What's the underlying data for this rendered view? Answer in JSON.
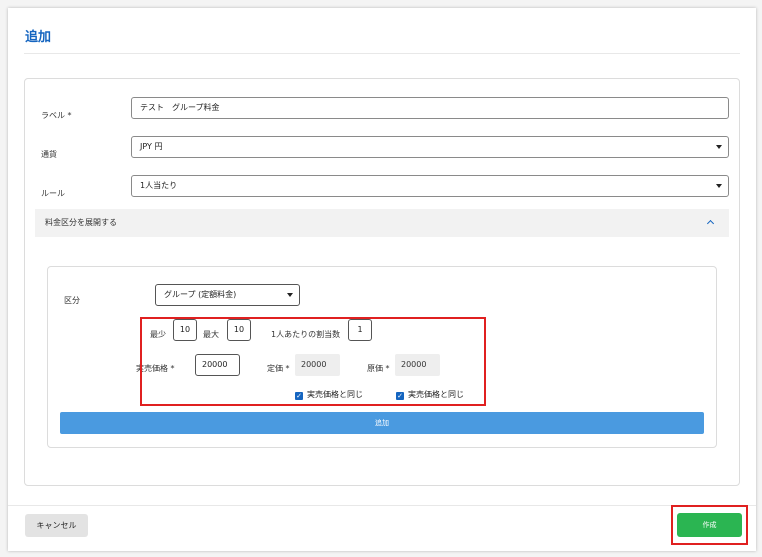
{
  "dialog": {
    "title": "追加"
  },
  "form": {
    "label_field": {
      "label": "ラベル *",
      "value": "テスト　グループ料金"
    },
    "currency_field": {
      "label": "通貨",
      "value": "JPY 円"
    },
    "rule_field": {
      "label": "ルール",
      "value": "1人当たり"
    },
    "expander": {
      "label": "料金区分を展開する"
    }
  },
  "pricing": {
    "category_label": "区分",
    "category_value": "グループ (定額料金)",
    "min_label": "最少",
    "min_value": "10",
    "max_label": "最大",
    "max_value": "10",
    "per_person_label": "1人あたりの割当数",
    "per_person_value": "1",
    "sale_price_label": "実売価格 *",
    "sale_price_value": "20000",
    "list_price_label": "定価 *",
    "list_price_value": "20000",
    "cost_price_label": "原価 *",
    "cost_price_value": "20000",
    "same_as_sale_1": "実売価格と同じ",
    "same_as_sale_2": "実売価格と同じ",
    "add_button": "追加"
  },
  "footer": {
    "cancel": "キャンセル",
    "create": "作成"
  },
  "colors": {
    "accent": "#1565c0",
    "add_button": "#4a9ae0",
    "create_button": "#2bb552",
    "highlight": "#e02020"
  }
}
